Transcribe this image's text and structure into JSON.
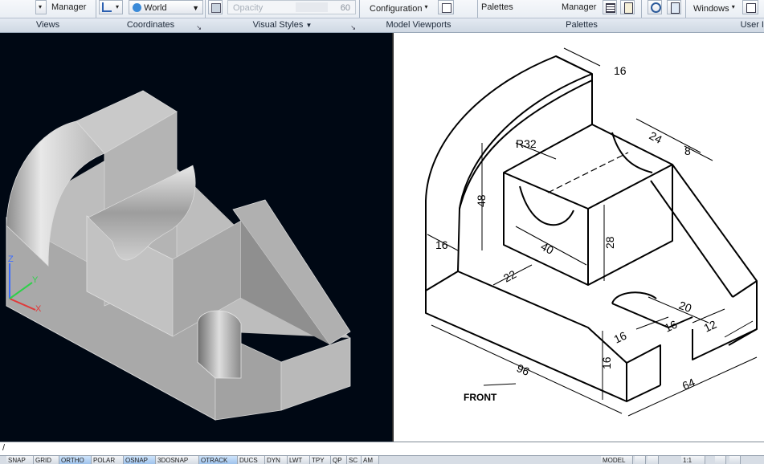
{
  "ribbon": {
    "views_manager": "Manager",
    "coord_ucs": "World",
    "opacity_label": "Opacity",
    "opacity_value": "60",
    "viewport_config": "Configuration",
    "palettes_label": "Palettes",
    "palettes_manager": "Manager",
    "windows_label": "Windows",
    "panels": [
      "Views",
      "Coordinates",
      "Visual Styles",
      "Model Viewports",
      "Palettes",
      "User I"
    ]
  },
  "drawing": {
    "dims": {
      "d16_top": "16",
      "d24": "24",
      "d8": "8",
      "r32": "R32",
      "d48": "48",
      "d16_left": "16",
      "d40": "40",
      "d28": "28",
      "d22": "22",
      "d20": "20",
      "d16_slot": "16",
      "d16_slot2": "16",
      "d12": "12",
      "d16_base": "16",
      "d96": "96",
      "d64": "64"
    },
    "front_label": "FRONT"
  },
  "ucs": {
    "x": "X",
    "y": "Y",
    "z": "Z"
  },
  "command_line": {
    "prompt": "/"
  },
  "status": {
    "toggles": [
      "SNAP",
      "GRID",
      "ORTHO",
      "POLAR",
      "OSNAP",
      "3DOSNAP",
      "OTRACK",
      "DUCS",
      "DYN",
      "LWT",
      "TPY",
      "QP",
      "SC",
      "AM"
    ],
    "active": [
      "ORTHO",
      "OSNAP",
      "OTRACK"
    ],
    "model": "MODEL",
    "scale": "1:1"
  },
  "colors": {
    "viewport_bg": "#000814",
    "ribbon_bg": "#dfe6ee",
    "solid_grey": "#bdbdbd"
  }
}
